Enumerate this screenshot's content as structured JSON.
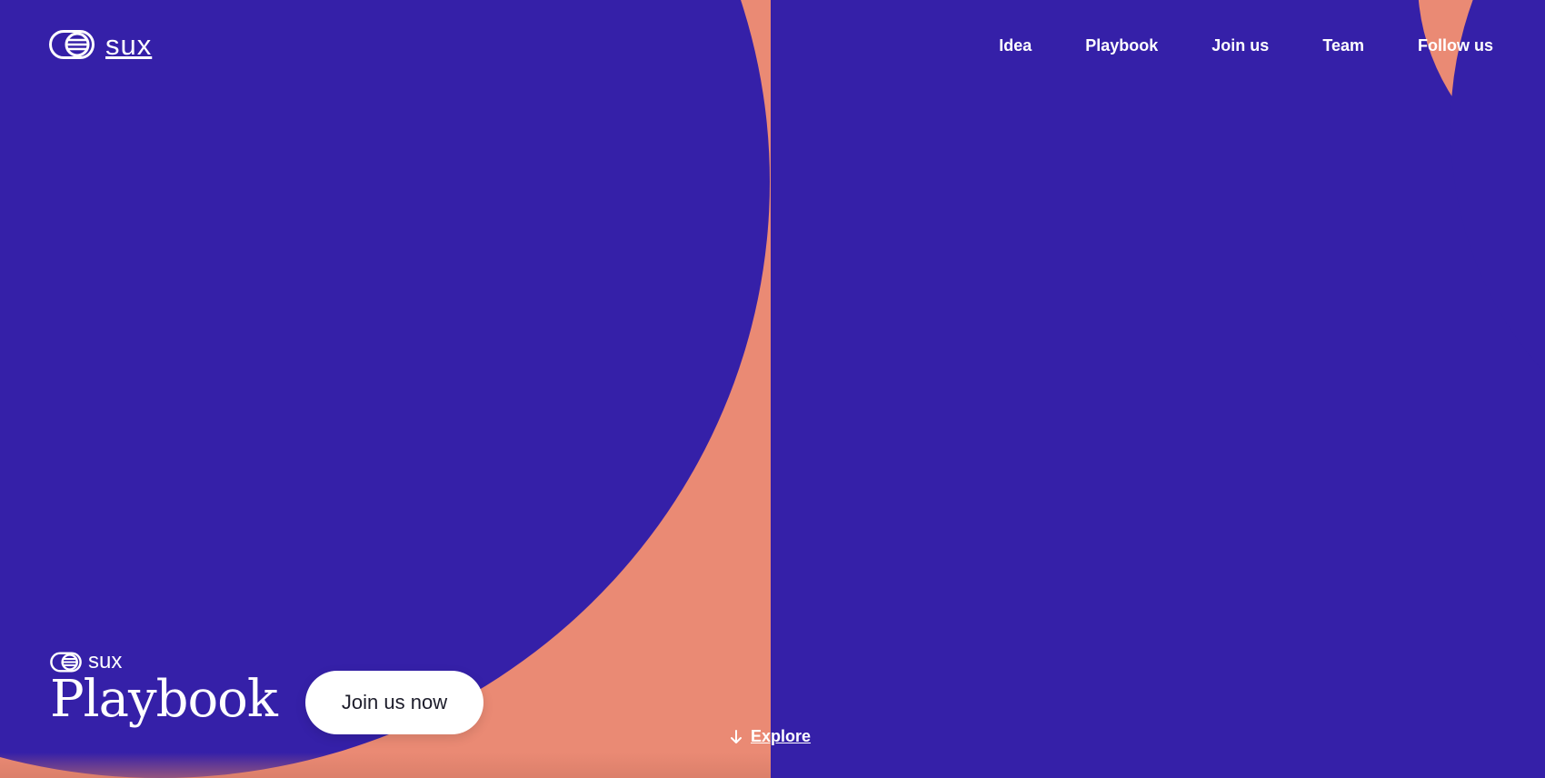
{
  "brand": {
    "name": "sux",
    "mini_name": "sux",
    "title": "Playbook",
    "colors": {
      "primary": "#3520a8",
      "accent": "#ea8a74",
      "text_light": "#ffffff"
    }
  },
  "nav": {
    "items": [
      {
        "label": "Idea"
      },
      {
        "label": "Playbook"
      },
      {
        "label": "Join us"
      },
      {
        "label": "Team"
      },
      {
        "label": "Follow us"
      }
    ]
  },
  "hero": {
    "cta_label": "Join us now",
    "explore_label": "Explore",
    "explore_icon": "arrow-down-icon"
  }
}
